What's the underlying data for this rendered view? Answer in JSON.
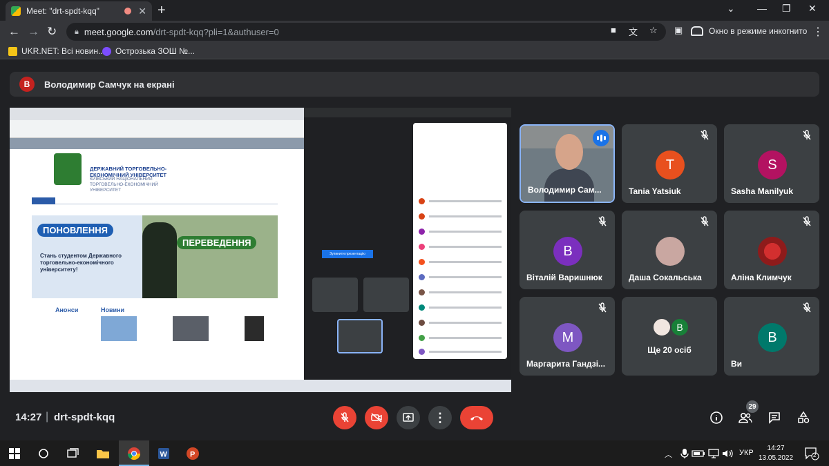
{
  "browser": {
    "tab_title": "Meet: \"drt-spdt-kqq\"",
    "url_host": "meet.google.com",
    "url_path": "/drt-spdt-kqq?pli=1&authuser=0",
    "incognito_label": "Окно в режиме инкогнито",
    "bookmarks": [
      "UKR.NET: Всі новин...",
      "Острозька ЗОШ №..."
    ]
  },
  "banner": {
    "avatar_letter": "В",
    "text": "Володимир Самчук на екрані"
  },
  "shared_screen": {
    "hero_badge_1": "ПОНОВЛЕННЯ",
    "hero_badge_2": "ПЕРЕВЕДЕННЯ",
    "hero_text": "Стань студентом Державного торговельно-економічного університету!",
    "university_name": "ДЕРЖАВНИЙ ТОРГОВЕЛЬНО-ЕКОНОМІЧНИЙ УНІВЕРСИТЕТ",
    "university_sub": "КИЇВСЬКИЙ НАЦІОНАЛЬНИЙ ТОРГОВЕЛЬНО-ЕКОНОМІЧНИЙ УНІВЕРСИТЕТ",
    "announcements": "Анонси",
    "news": "Новини",
    "present_button": "Зупинити презентацію"
  },
  "participants": [
    {
      "name": "Володимир Сам...",
      "letter": "",
      "color": "#3c4043",
      "video": true,
      "speaking": true
    },
    {
      "name": "Tania Yatsiuk",
      "letter": "T",
      "color": "#e8501e",
      "video": false
    },
    {
      "name": "Sasha Manilyuk",
      "letter": "S",
      "color": "#b31261",
      "video": false
    },
    {
      "name": "Віталій Варишнюк",
      "letter": "В",
      "color": "#7b2fbe",
      "video": false
    },
    {
      "name": "Даша Сокальська",
      "letter": "",
      "color": "#c9a7a1",
      "video": false
    },
    {
      "name": "Аліна Климчук",
      "letter": "",
      "color": "#8e1b1b",
      "video": false
    },
    {
      "name": "Маргарита Гандзі...",
      "letter": "М",
      "color": "#7e57c2",
      "video": false
    },
    {
      "name": "Ще 20 осіб",
      "letter": "В",
      "color": "#188038",
      "video": false
    },
    {
      "name": "Ви",
      "letter": "В",
      "color": "#00796b",
      "video": false
    }
  ],
  "controls": {
    "time": "14:27",
    "separator": "|",
    "meeting_code": "drt-spdt-kqq",
    "participant_count": "29"
  },
  "taskbar": {
    "language": "УКР",
    "clock_time": "14:27",
    "clock_date": "13.05.2022",
    "notifications": "2"
  }
}
